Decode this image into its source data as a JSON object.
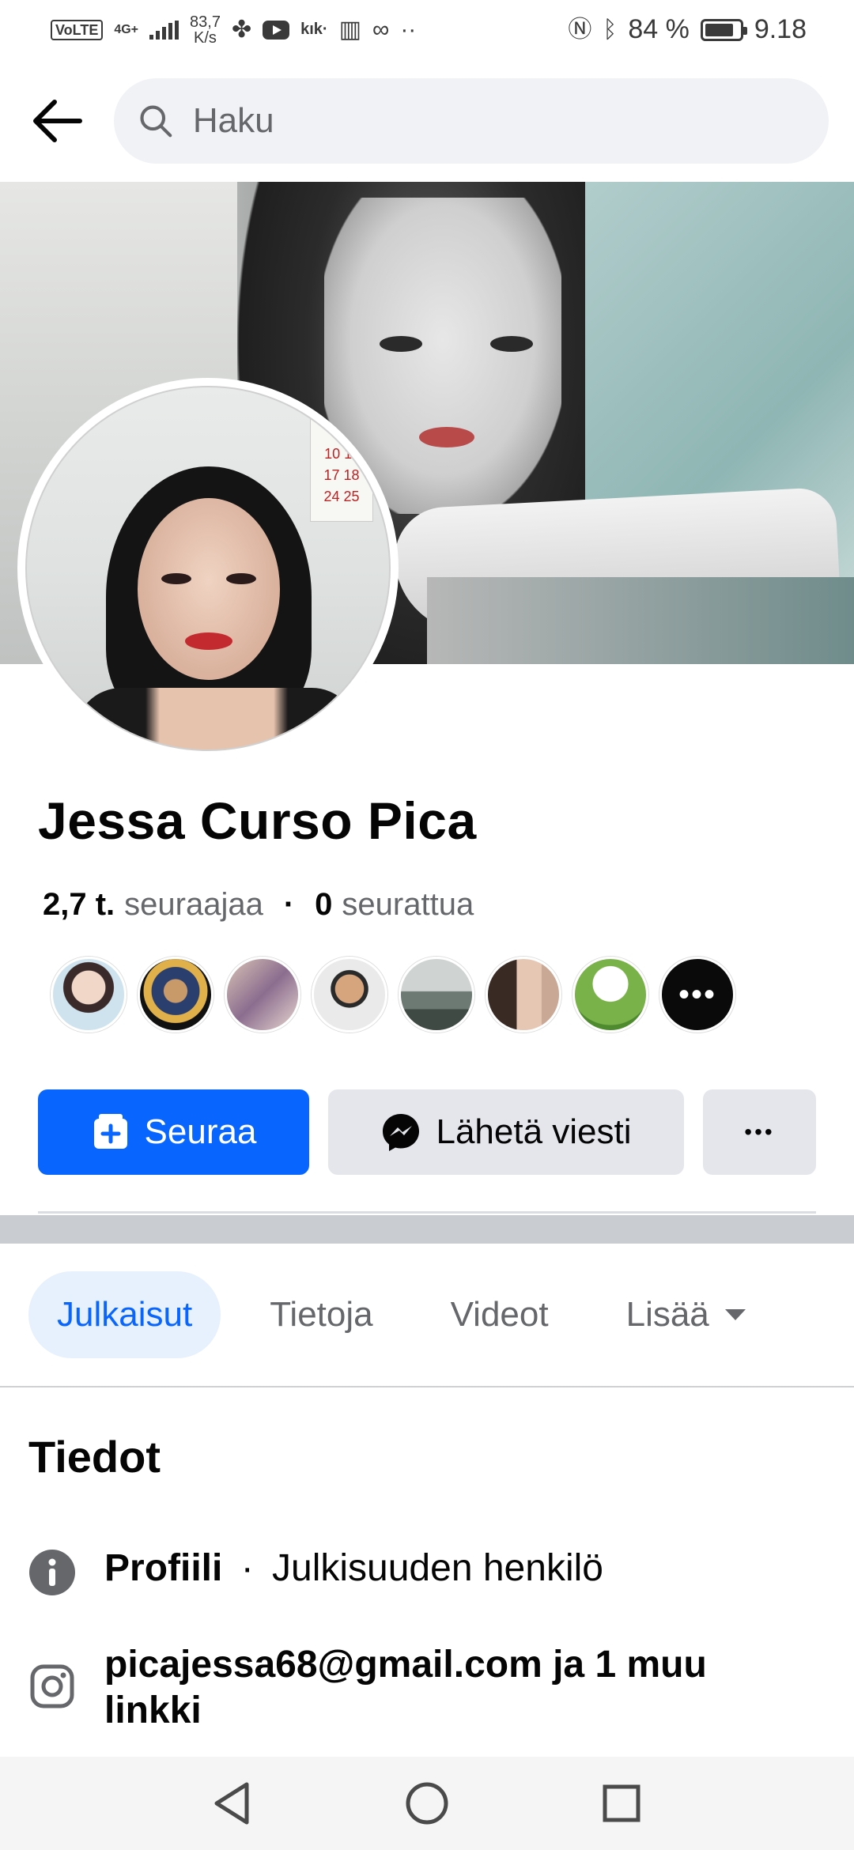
{
  "status_bar": {
    "volte": "VoLTE",
    "network": "4G+",
    "speed_value": "83,7",
    "speed_unit": "K/s",
    "kik": "kık·",
    "dots": "··",
    "battery": "84 %",
    "battery_level": 0.84,
    "time": "9.18"
  },
  "search": {
    "placeholder": "Haku"
  },
  "profile": {
    "name": "Jessa Curso Pica",
    "followers_count": "2,7 t.",
    "followers_label": "seuraajaa",
    "following_count": "0",
    "following_label": "seurattua"
  },
  "actions": {
    "follow_label": "Seuraa",
    "message_label": "Lähetä viesti",
    "more_label": "•••"
  },
  "tabs": [
    {
      "label": "Julkaisut",
      "active": true
    },
    {
      "label": "Tietoja",
      "active": false
    },
    {
      "label": "Videot",
      "active": false
    },
    {
      "label": "Lisää",
      "active": false
    }
  ],
  "details": {
    "title": "Tiedot",
    "profile_label": "Profiili",
    "profile_sep": "·",
    "profile_value": "Julkisuuden henkilö",
    "link_text": "picajessa68@gmail.com ja 1 muu linkki"
  },
  "follower_avatars_more": "•••",
  "colors": {
    "primary": "#0866ff",
    "button_gray": "#e4e6eb",
    "search_bg": "#f0f2f5",
    "muted_text": "#65676b"
  },
  "icons": {
    "back": "arrow-left-icon",
    "search": "search-icon",
    "follow": "follow-plus-icon",
    "messenger": "messenger-icon",
    "info": "info-icon",
    "instagram": "instagram-icon",
    "nav_back": "triangle-back-icon",
    "nav_home": "circle-home-icon",
    "nav_recents": "square-recents-icon"
  }
}
